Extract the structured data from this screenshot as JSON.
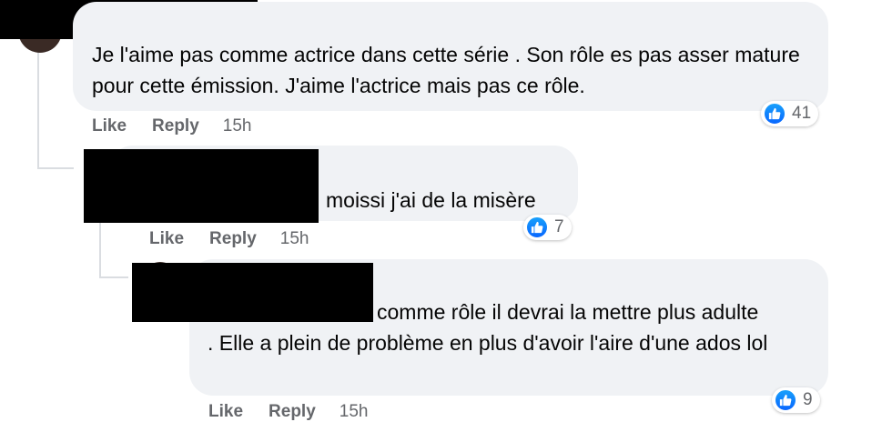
{
  "comments": [
    {
      "text": "Je l'aime pas comme actrice dans cette série . Son rôle es pas asser mature pour cette émission. J'aime l'actrice mais pas ce rôle.",
      "like_label": "Like",
      "reply_label": "Reply",
      "time": "15h",
      "reaction_count": "41"
    },
    {
      "text": "moissi j'ai de la misère",
      "like_label": "Like",
      "reply_label": "Reply",
      "time": "15h",
      "reaction_count": "7"
    },
    {
      "text_first": "comme rôle il devrai la mettre plus adulte",
      "text_rest": ". Elle a plein de problème en plus d'avoir l'aire d'une ados lol",
      "like_label": "Like",
      "reply_label": "Reply",
      "time": "15h",
      "reaction_count": "9"
    }
  ],
  "colors": {
    "bubble": "#f0f2f5",
    "meta_text": "#65676b",
    "like_blue": "#0866ff"
  },
  "icons": {
    "reaction": "like-thumb-icon"
  }
}
